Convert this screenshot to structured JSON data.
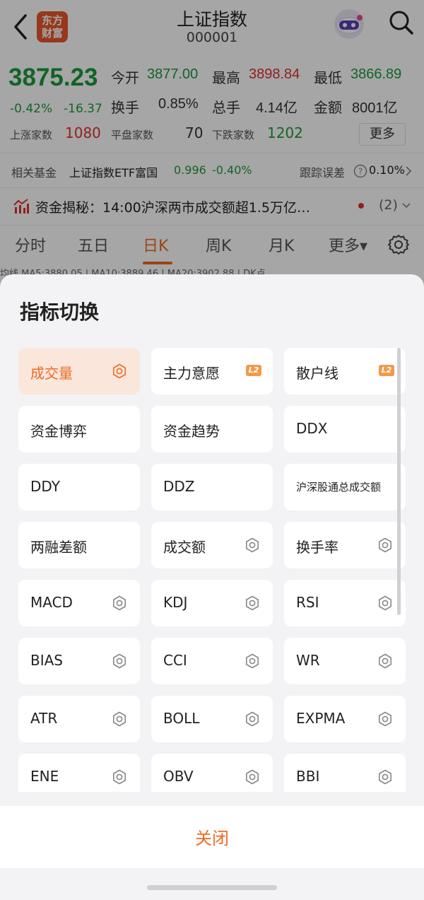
{
  "header": {
    "logo_line1": "东方",
    "logo_line2": "财富",
    "title": "上证指数",
    "code": "000001"
  },
  "quote": {
    "price": "3875.23",
    "change_pct": "-0.42%",
    "change": "-16.37",
    "open_label": "今开",
    "open": "3877.00",
    "high_label": "最高",
    "high": "3898.84",
    "low_label": "最低",
    "low": "3866.89",
    "turnover_label": "换手",
    "turnover": "0.85%",
    "volume_label": "总手",
    "volume": "4.14亿",
    "amount_label": "金额",
    "amount": "8001亿",
    "up_label": "上涨家数",
    "up": "1080",
    "flat_label": "平盘家数",
    "flat": "70",
    "down_label": "下跌家数",
    "down": "1202",
    "more_label": "更多"
  },
  "fund": {
    "label": "相关基金",
    "name": "上证指数ETF富国",
    "price": "0.996",
    "change": "-0.40%",
    "tracking_label": "跟踪误差",
    "tracking_value": "0.10%"
  },
  "news": {
    "text": "资金揭秘：14:00沪深两市成交额超1.5万亿…",
    "count": "(2)"
  },
  "tabs": {
    "items": [
      "分时",
      "五日",
      "日K",
      "周K",
      "月K",
      "更多▾"
    ],
    "active": "日K"
  },
  "ma_line": "均线  MA5:3880.05 | MA10:3889.46 | MA20:3902.88 | DK点",
  "sheet": {
    "title": "指标切换",
    "items": [
      {
        "label": "成交量",
        "badge": "gear",
        "active": true
      },
      {
        "label": "主力意愿",
        "badge": "L2"
      },
      {
        "label": "散户线",
        "badge": "L2"
      },
      {
        "label": "资金博弈",
        "badge": ""
      },
      {
        "label": "资金趋势",
        "badge": ""
      },
      {
        "label": "DDX",
        "badge": ""
      },
      {
        "label": "DDY",
        "badge": ""
      },
      {
        "label": "DDZ",
        "badge": ""
      },
      {
        "label": "沪深股通总成交额",
        "badge": ""
      },
      {
        "label": "两融差额",
        "badge": ""
      },
      {
        "label": "成交额",
        "badge": "gear"
      },
      {
        "label": "换手率",
        "badge": "gear"
      },
      {
        "label": "MACD",
        "badge": "gear"
      },
      {
        "label": "KDJ",
        "badge": "gear"
      },
      {
        "label": "RSI",
        "badge": "gear"
      },
      {
        "label": "BIAS",
        "badge": "gear"
      },
      {
        "label": "CCI",
        "badge": "gear"
      },
      {
        "label": "WR",
        "badge": "gear"
      },
      {
        "label": "ATR",
        "badge": "gear"
      },
      {
        "label": "BOLL",
        "badge": "gear"
      },
      {
        "label": "EXPMA",
        "badge": "gear"
      },
      {
        "label": "ENE",
        "badge": "gear"
      },
      {
        "label": "OBV",
        "badge": "gear"
      },
      {
        "label": "BBI",
        "badge": "gear"
      }
    ],
    "close_label": "关闭"
  },
  "colors": {
    "accent": "#ef6a22",
    "up": "#e0302b",
    "down": "#1d9a3c"
  }
}
